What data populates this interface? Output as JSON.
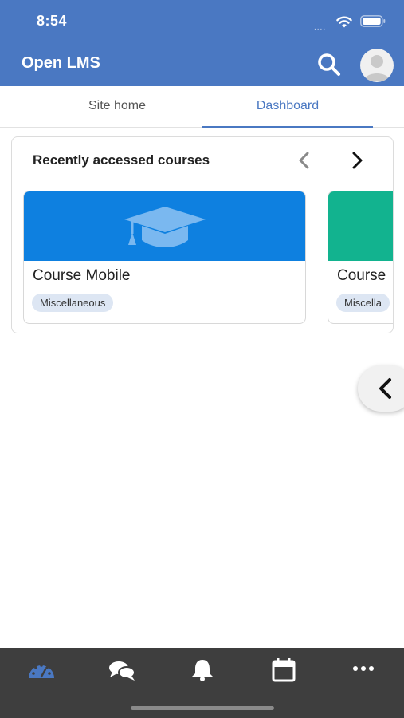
{
  "status_bar": {
    "time": "8:54",
    "signal": "....",
    "wifi_icon": "wifi-icon",
    "battery_icon": "battery-icon"
  },
  "header": {
    "title": "Open LMS",
    "search_icon": "search-icon",
    "avatar": "user-avatar"
  },
  "tabs": [
    {
      "label": "Site home",
      "active": false
    },
    {
      "label": "Dashboard",
      "active": true
    }
  ],
  "recent_courses": {
    "title": "Recently accessed courses",
    "courses": [
      {
        "name": "Course Mobile",
        "category": "Miscellaneous",
        "color": "#0e80e0"
      },
      {
        "name": "Course",
        "category": "Miscella",
        "color": "#12b38f"
      }
    ]
  },
  "bottom_nav": [
    {
      "icon": "dashboard-gauge-icon",
      "active": true
    },
    {
      "icon": "messages-icon",
      "active": false
    },
    {
      "icon": "bell-icon",
      "active": false
    },
    {
      "icon": "calendar-icon",
      "active": false
    },
    {
      "icon": "more-icon",
      "active": false
    }
  ],
  "colors": {
    "brand": "#4a78c2",
    "bottom_bar": "#3e3e3e",
    "badge_bg": "#dde6f3"
  }
}
